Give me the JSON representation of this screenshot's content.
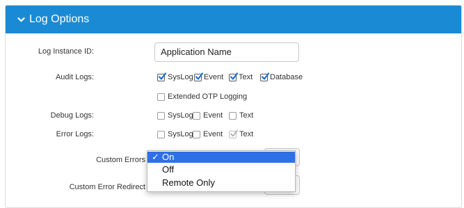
{
  "header": {
    "title": "Log Options"
  },
  "instance": {
    "label": "Log Instance ID:",
    "value": "Application Name"
  },
  "audit": {
    "label": "Audit Logs:",
    "options": [
      {
        "label": "SysLog",
        "checked": true
      },
      {
        "label": "Event",
        "checked": true
      },
      {
        "label": "Text",
        "checked": true
      },
      {
        "label": "Database",
        "checked": true
      }
    ],
    "extended": {
      "label": "Extended OTP Logging",
      "checked": false
    }
  },
  "debug": {
    "label": "Debug Logs:",
    "options": [
      {
        "label": "SysLog",
        "checked": false
      },
      {
        "label": "Event",
        "checked": false
      },
      {
        "label": "Text",
        "checked": false
      }
    ]
  },
  "error": {
    "label": "Error Logs:",
    "options": [
      {
        "label": "SysLog",
        "checked": false
      },
      {
        "label": "Event",
        "checked": false
      },
      {
        "label": "Text",
        "checked": true,
        "disabled": true
      }
    ]
  },
  "custom_errors": {
    "label": "Custom Errors",
    "options": [
      "On",
      "Off",
      "Remote Only"
    ],
    "selected": "On",
    "check_glyph": "✓"
  },
  "redirect": {
    "label": "Custom Error Redirect"
  },
  "colors": {
    "header": "#1a8ad4",
    "selected_option": "#2f70e8"
  }
}
